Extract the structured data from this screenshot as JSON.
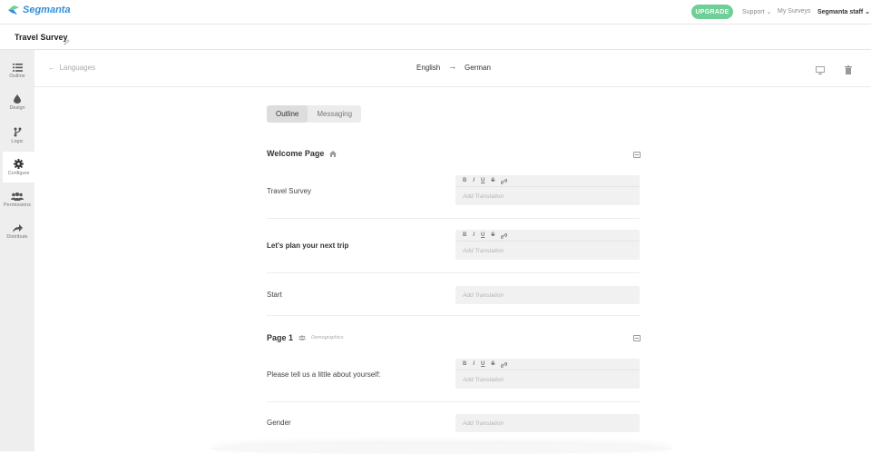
{
  "brand": {
    "name": "Segmanta",
    "color": "#2f8fd6"
  },
  "topnav": {
    "upgrade_label": "UPGRADE",
    "support_label": "Support ⌄",
    "my_surveys_label": "My Surveys",
    "user_label": "Segmanta staff ⌄",
    "accent": "#6fcf97"
  },
  "survey": {
    "title": "Travel Survey"
  },
  "sidebar": {
    "items": [
      {
        "label": "Outline",
        "icon": "list-icon"
      },
      {
        "label": "Design",
        "icon": "droplet-icon"
      },
      {
        "label": "Logic",
        "icon": "branch-icon"
      },
      {
        "label": "Configure",
        "icon": "gear-icon",
        "active": true
      },
      {
        "label": "Permissions",
        "icon": "users-icon"
      },
      {
        "label": "Distribute",
        "icon": "share-icon"
      }
    ]
  },
  "subheader": {
    "back_label": "Languages",
    "source_language": "English",
    "arrow": "→",
    "target_language": "German"
  },
  "tabs": [
    {
      "label": "Outline",
      "active": true
    },
    {
      "label": "Messaging",
      "active": false
    }
  ],
  "toolbar": {
    "bold": "B",
    "italic": "I",
    "underline": "U",
    "strike": "S"
  },
  "placeholder": "Add Translation",
  "sections": [
    {
      "title": "Welcome Page",
      "rows": [
        {
          "label": "Travel Survey"
        },
        {
          "label": "Let's plan your next trip"
        },
        {
          "label": "Start"
        }
      ]
    },
    {
      "title": "Page 1",
      "subtitle": "Demographics",
      "rows": [
        {
          "label": "Please tell us a little about yourself:"
        },
        {
          "label": "Gender"
        }
      ]
    }
  ]
}
